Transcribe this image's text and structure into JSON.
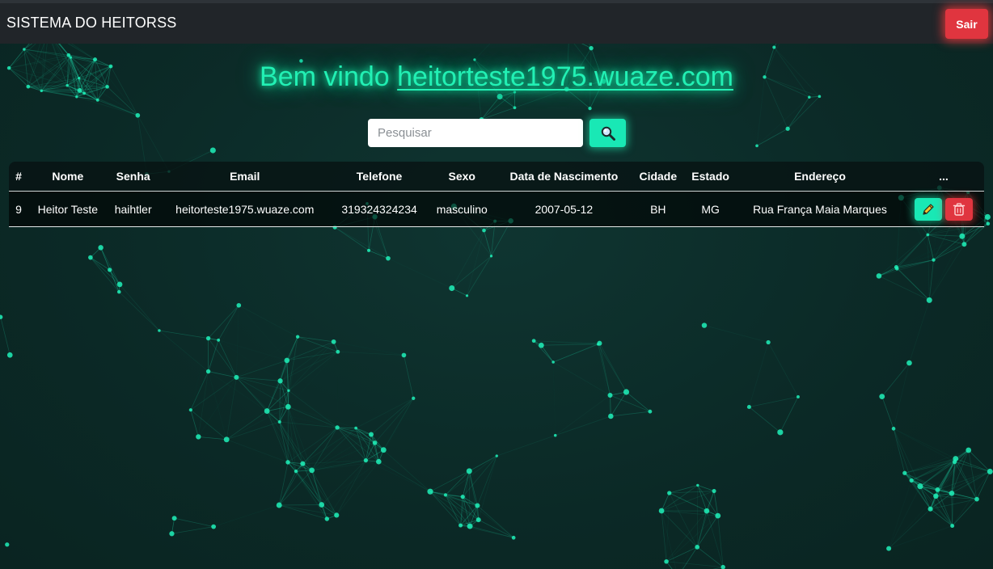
{
  "navbar": {
    "brand": "SISTEMA DO HEITORSS",
    "logout_label": "Sair"
  },
  "welcome": {
    "prefix": "Bem vindo ",
    "user": "heitorteste1975.wuaze.com"
  },
  "search": {
    "placeholder": "Pesquisar",
    "value": "",
    "button_icon": "search-icon"
  },
  "table": {
    "headers": [
      "#",
      "Nome",
      "Senha",
      "Email",
      "Telefone",
      "Sexo",
      "Data de Nascimento",
      "Cidade",
      "Estado",
      "Endereço",
      "..."
    ],
    "rows": [
      {
        "id": "9",
        "nome": "Heitor Teste",
        "senha": "haihtler",
        "email": "heitorteste1975.wuaze.com",
        "telefone": "319324324234",
        "sexo": "masculino",
        "nascimento": "2007-05-12",
        "cidade": "BH",
        "estado": "MG",
        "endereco": "Rua França Maia Marques",
        "actions": [
          "pencil-icon",
          "trash-icon"
        ]
      }
    ]
  },
  "colors": {
    "accent": "#19e8b5",
    "danger": "#e0353f",
    "navbar": "#212529",
    "background": "#0c2a27"
  },
  "background_decoration": "particles-network"
}
